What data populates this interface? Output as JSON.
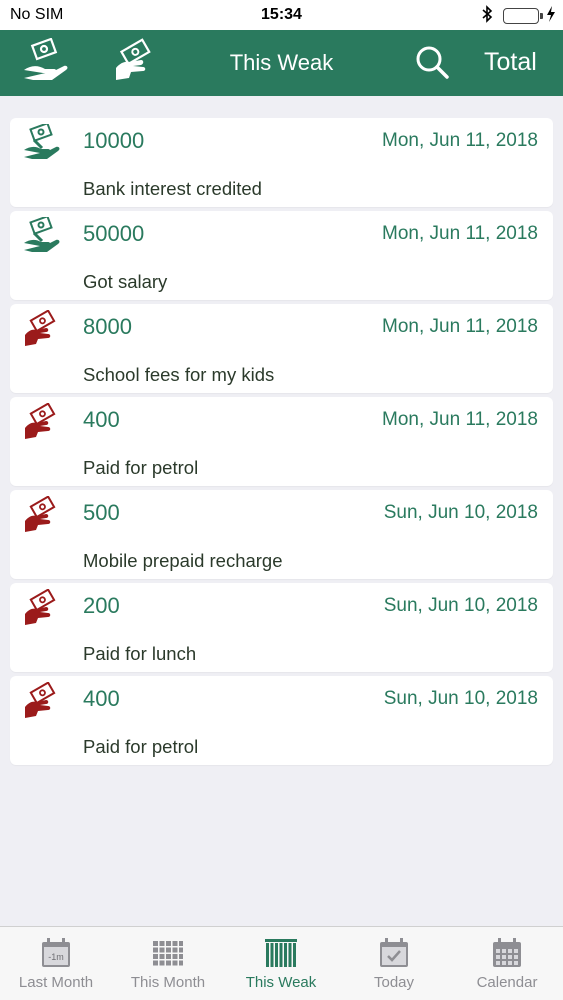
{
  "status_bar": {
    "carrier": "No SIM",
    "time": "15:34"
  },
  "nav": {
    "title": "This Weak",
    "total_label": "Total",
    "icons": [
      "income-icon",
      "expense-icon",
      "search-icon"
    ]
  },
  "colors": {
    "brand_green": "#2a7a5e",
    "income": "#2a7a5e",
    "expense": "#9b1b1b",
    "background": "#efeff4"
  },
  "entries": [
    {
      "type": "income",
      "amount": "10000",
      "date": "Mon, Jun 11, 2018",
      "description": "Bank interest credited"
    },
    {
      "type": "income",
      "amount": "50000",
      "date": "Mon, Jun 11, 2018",
      "description": "Got salary"
    },
    {
      "type": "expense",
      "amount": "8000",
      "date": "Mon, Jun 11, 2018",
      "description": "School fees for my kids"
    },
    {
      "type": "expense",
      "amount": "400",
      "date": "Mon, Jun 11, 2018",
      "description": "Paid for petrol"
    },
    {
      "type": "expense",
      "amount": "500",
      "date": "Sun, Jun 10, 2018",
      "description": "Mobile prepaid recharge"
    },
    {
      "type": "expense",
      "amount": "200",
      "date": "Sun, Jun 10, 2018",
      "description": "Paid for lunch"
    },
    {
      "type": "expense",
      "amount": "400",
      "date": "Sun, Jun 10, 2018",
      "description": "Paid for petrol"
    }
  ],
  "tabs": [
    {
      "label": "Last Month",
      "icon": "calendar-minus-icon",
      "badge": "-1m",
      "active": false
    },
    {
      "label": "This Month",
      "icon": "month-grid-icon",
      "active": false
    },
    {
      "label": "This Weak",
      "icon": "week-bars-icon",
      "active": true
    },
    {
      "label": "Today",
      "icon": "calendar-check-icon",
      "active": false
    },
    {
      "label": "Calendar",
      "icon": "calendar-icon",
      "active": false
    }
  ]
}
